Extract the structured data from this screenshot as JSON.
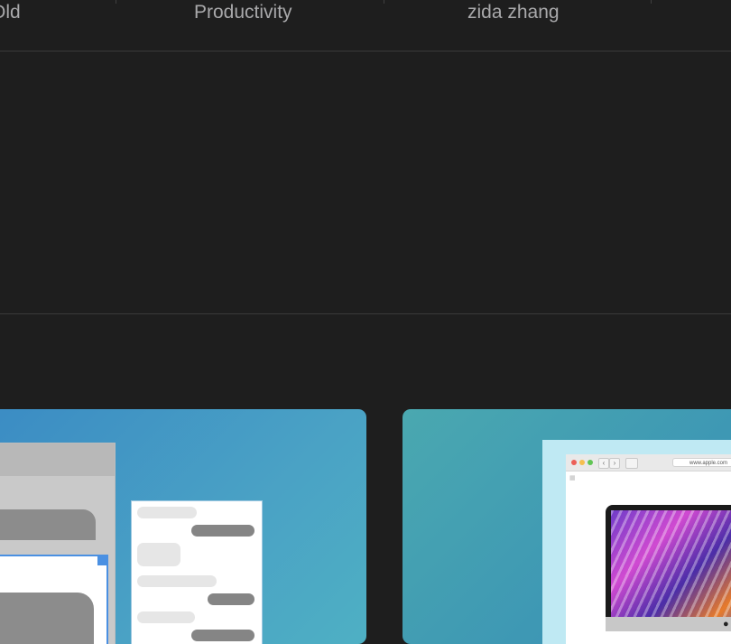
{
  "tabs": [
    {
      "label": "Old"
    },
    {
      "label": "Productivity"
    },
    {
      "label": "zida zhang"
    }
  ],
  "safari": {
    "url": "www.apple.com",
    "nav_back": "‹",
    "nav_forward": "›"
  },
  "colors": {
    "background": "#1e1e1e",
    "tab_text": "#a9a9ab",
    "divider": "#3a3a3a",
    "accent_selection": "#4a90e2",
    "traffic_red": "#ec5f57",
    "traffic_yellow": "#f5bf4f",
    "traffic_green": "#61c554"
  }
}
